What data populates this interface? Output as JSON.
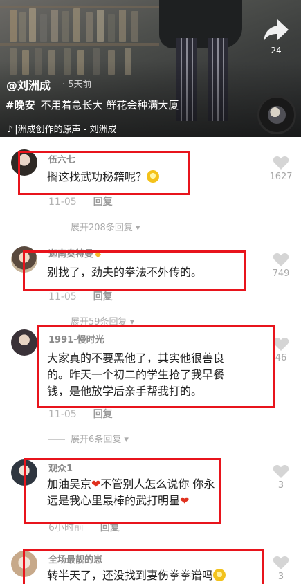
{
  "video": {
    "share_count": "24",
    "author": "@刘洲成",
    "posted": "· 5天前",
    "hashtag": "#晚安",
    "caption": "不用着急长大 鲜花会种满大厦",
    "music": "|洲成创作的原声 - 刘洲成"
  },
  "comments": [
    {
      "user": "伍六七",
      "text": "搁这找武功秘籍呢？",
      "date": "11-05",
      "reply": "回复",
      "expand": "展开208条回复",
      "likes": "1627"
    },
    {
      "user": "迦南奥特曼",
      "text": "别找了，劲夫的拳法不外传的。",
      "date": "11-05",
      "reply": "回复",
      "expand": "展开59条回复",
      "likes": "749"
    },
    {
      "user": "1991-慢时光",
      "line1": "大家真的不要黑他了，其实他很善良",
      "line2": "的。昨天一个初二的学生抢了我早餐",
      "line3": "钱，是他放学后亲手帮我打的。",
      "date": "11-05",
      "reply": "回复",
      "expand": "展开6条回复",
      "likes": "46"
    },
    {
      "user": "观众1",
      "line1a": "加油吴京",
      "line1b": "不管别人怎么说你   你永",
      "line2": "远是我心里最棒的武打明星",
      "date": "6小时前",
      "reply": "回复",
      "likes": "3"
    },
    {
      "user": "全场最靓的崽",
      "text": "转半天了，还没找到妻伤拳拳谱吗",
      "likes": "3"
    }
  ],
  "colors": {
    "highlight_box": "#e8141c",
    "heart": "#d5d5d5"
  }
}
